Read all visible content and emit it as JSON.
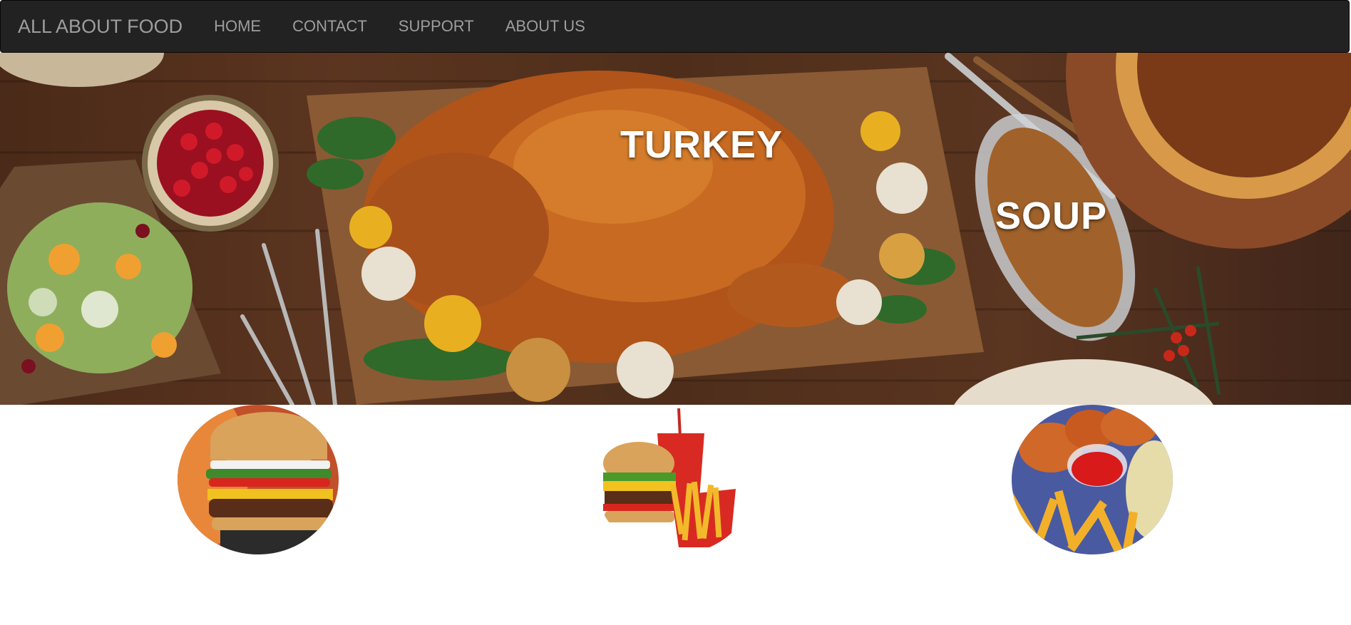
{
  "navbar": {
    "brand": "ALL ABOUT FOOD",
    "links": [
      "HOME",
      "CONTACT",
      "SUPPORT",
      "ABOUT US"
    ]
  },
  "hero": {
    "captions": [
      "TURKEY",
      "SOUP"
    ]
  },
  "featured": [
    {
      "name": "burger-image",
      "icon": "burger"
    },
    {
      "name": "combo-meal-image",
      "icon": "burger-fries-drink"
    },
    {
      "name": "wings-fries-image",
      "icon": "wings-fries"
    }
  ],
  "colors": {
    "navbar_bg": "#222222",
    "nav_text": "#9d9d9d",
    "caption_text": "#ffffff"
  }
}
